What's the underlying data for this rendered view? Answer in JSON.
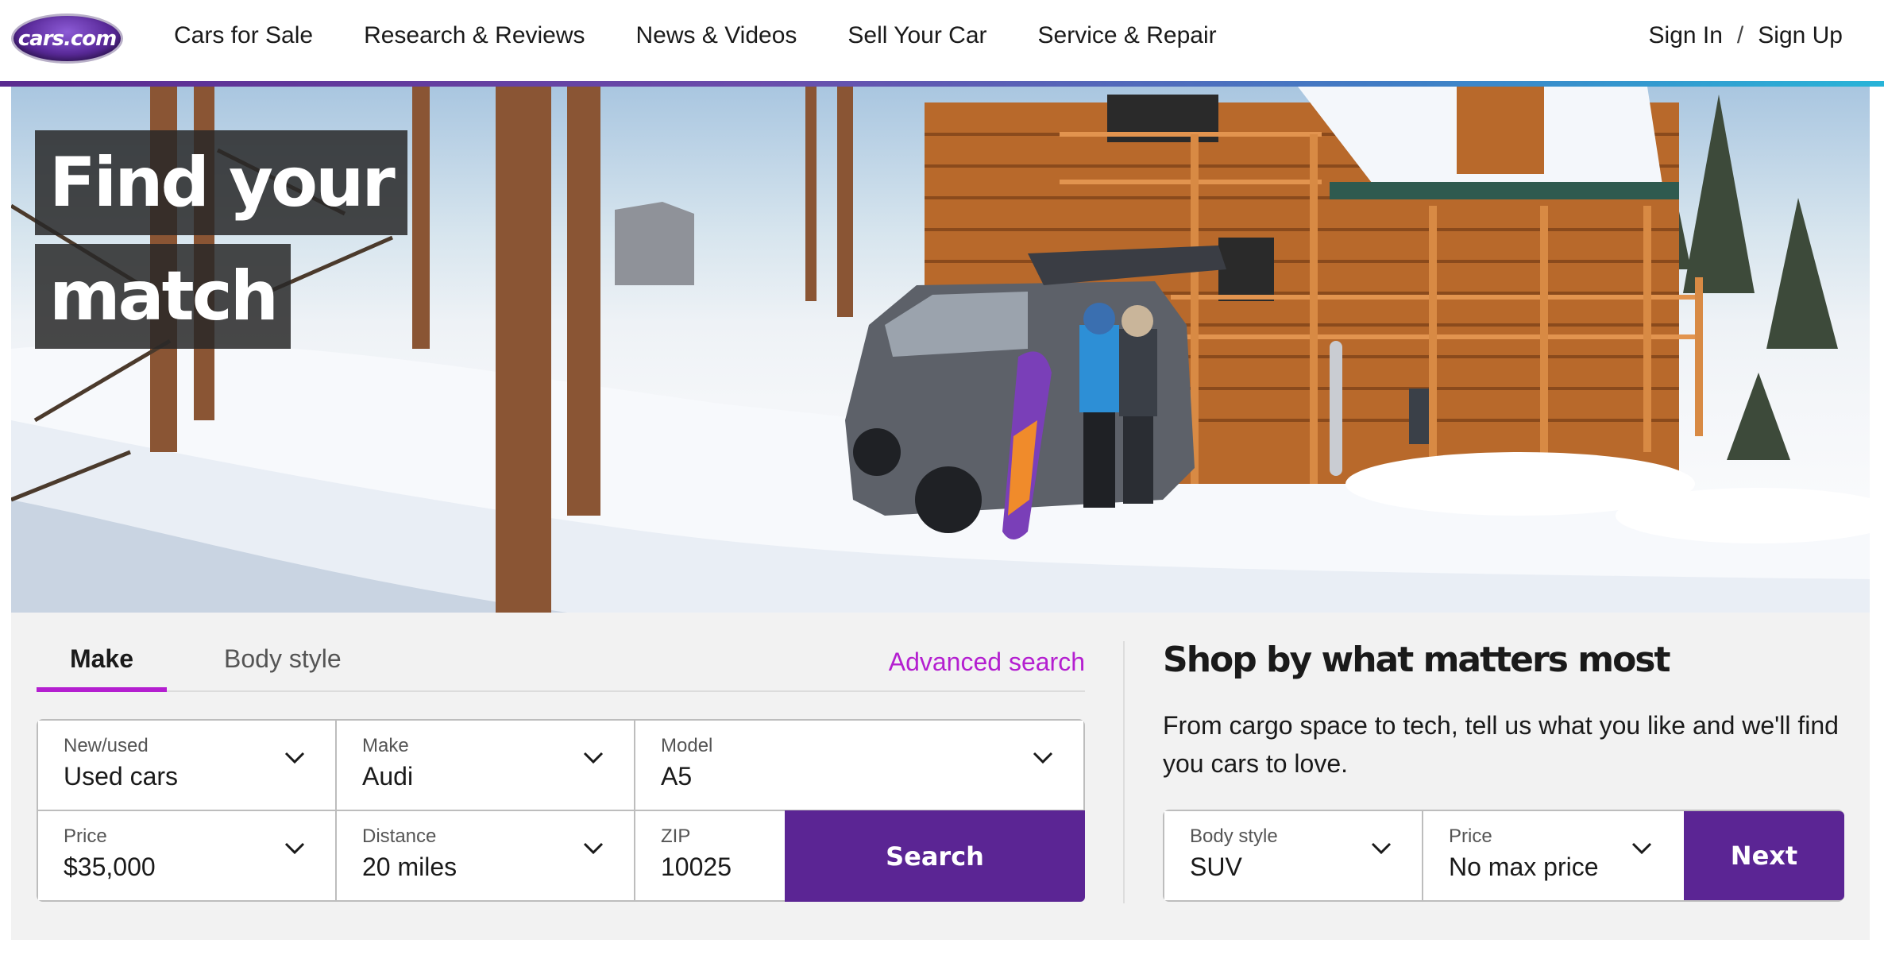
{
  "header": {
    "logo_text": "cars.com",
    "nav": [
      "Cars for Sale",
      "Research & Reviews",
      "News & Videos",
      "Sell Your Car",
      "Service & Repair"
    ],
    "sign_in": "Sign In",
    "separator": "/",
    "sign_up": "Sign Up"
  },
  "hero": {
    "headline_line1": "Find your",
    "headline_line2": "match"
  },
  "search": {
    "tabs": [
      "Make",
      "Body style"
    ],
    "active_tab": "Make",
    "advanced_link": "Advanced search",
    "fields": {
      "new_used": {
        "label": "New/used",
        "value": "Used cars"
      },
      "make": {
        "label": "Make",
        "value": "Audi"
      },
      "model": {
        "label": "Model",
        "value": "A5"
      },
      "price": {
        "label": "Price",
        "value": "$35,000"
      },
      "distance": {
        "label": "Distance",
        "value": "20 miles"
      },
      "zip": {
        "label": "ZIP",
        "value": "10025"
      }
    },
    "search_button": "Search"
  },
  "shop": {
    "title": "Shop by what matters most",
    "description": "From cargo space to tech, tell us what you like and we'll find you cars to love.",
    "body_style": {
      "label": "Body style",
      "value": "SUV"
    },
    "price": {
      "label": "Price",
      "value": "No max price"
    },
    "next_button": "Next"
  },
  "colors": {
    "brand_purple": "#5b2594",
    "accent_magenta": "#b41fd0",
    "band_background": "#f2f2f2"
  }
}
